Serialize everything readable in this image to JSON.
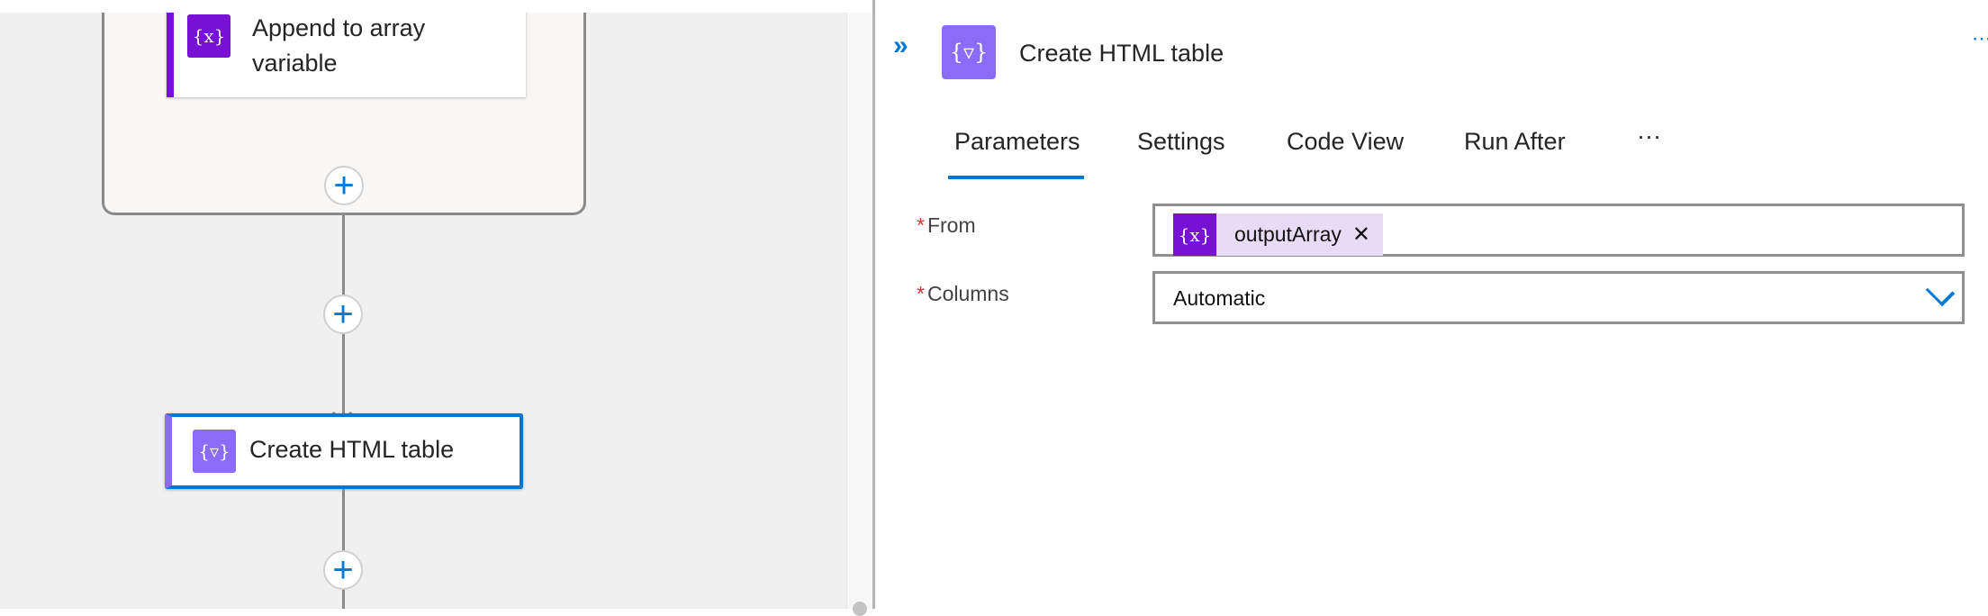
{
  "canvas": {
    "append_card": {
      "title": "Append to array variable",
      "icon": "variable-icon",
      "icon_glyph": "{x}"
    },
    "create_card": {
      "title": "Create HTML table",
      "icon": "data-operation-icon",
      "icon_glyph": "{▿}"
    },
    "plus_glyph": "+"
  },
  "panel": {
    "expand_glyph": "»",
    "title": "Create HTML table",
    "more_glyph": "⋯",
    "tabs": [
      {
        "label": "Parameters",
        "active": true
      },
      {
        "label": "Settings"
      },
      {
        "label": "Code View"
      },
      {
        "label": "Run After"
      },
      {
        "label": "···"
      }
    ],
    "fields": {
      "from": {
        "label": "From",
        "required": "*",
        "token": {
          "icon_glyph": "{x}",
          "label": "outputArray",
          "remove_glyph": "✕"
        }
      },
      "columns": {
        "label": "Columns",
        "required": "*",
        "value": "Automatic"
      }
    }
  },
  "colors": {
    "accent": "#0078d4",
    "variable": "#7711d6",
    "data_op": "#8b6cf7",
    "required": "#d13438"
  }
}
